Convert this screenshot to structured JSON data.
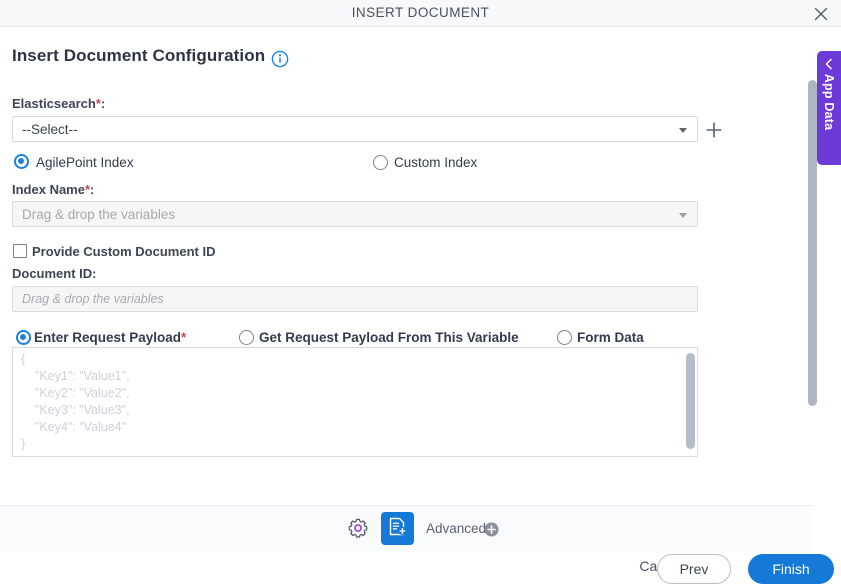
{
  "window": {
    "title": "INSERT DOCUMENT",
    "close_icon": "close-icon"
  },
  "header": {
    "title": "Insert Document Configuration",
    "info_icon": "info-circle-icon"
  },
  "form": {
    "elasticsearch": {
      "label": "Elasticsearch",
      "required_mark": "*",
      "label_suffix": ":",
      "value": "--Select--",
      "dropdown_icon": "chevron-down-icon",
      "add_icon": "plus-icon"
    },
    "index_source": {
      "options": [
        {
          "label": "AgilePoint Index",
          "selected": true
        },
        {
          "label": "Custom Index",
          "selected": false
        }
      ]
    },
    "index_name": {
      "label": "Index Name",
      "required_mark": "*",
      "label_suffix": ":",
      "placeholder": "Drag & drop the variables",
      "value": "",
      "dropdown_icon": "chevron-down-icon"
    },
    "provide_custom_document_id": {
      "label": "Provide Custom Document ID",
      "checked": false
    },
    "document_id": {
      "label": "Document ID",
      "label_suffix": ":",
      "placeholder": "Drag & drop the variables",
      "value": ""
    },
    "payload_mode": {
      "options": [
        {
          "label": "Enter Request Payload",
          "required_mark": "*",
          "selected": true
        },
        {
          "label": "Get Request Payload From This Variable",
          "required_mark": "",
          "selected": false
        },
        {
          "label": "Form Data",
          "required_mark": "",
          "selected": false
        }
      ]
    },
    "request_payload": {
      "value": "",
      "placeholder": "{\n    \"Key1\": \"Value1\",\n    \"Key2\": \"Value2\",\n    \"Key3\": \"Value3\",\n    \"Key4\": \"Value4\"\n}"
    }
  },
  "footer": {
    "gear_icon": "gear-icon",
    "document_icon": "document-add-icon",
    "advanced_label": "Advanced",
    "advanced_plus_icon": "plus-circle-icon",
    "cancel_label": "Cancel",
    "prev_label": "Prev",
    "finish_label": "Finish"
  },
  "right_rail": {
    "app_data_label": "App Data",
    "collapse_icon": "chevron-left-icon"
  },
  "colors": {
    "accent_blue": "#1579d8",
    "purple": "#6c3ad6",
    "required_red": "#c8484d",
    "titlebar_bg": "#f7f8fa",
    "footer_bg": "#fafbfc"
  }
}
